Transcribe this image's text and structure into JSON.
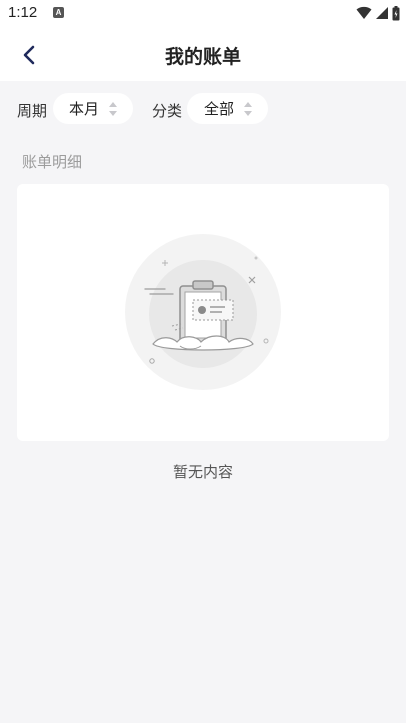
{
  "status_bar": {
    "time": "1:12",
    "app_icon_letter": "A"
  },
  "header": {
    "title": "我的账单"
  },
  "filters": {
    "period_label": "周期",
    "period_value": "本月",
    "category_label": "分类",
    "category_value": "全部"
  },
  "section": {
    "title": "账单明细"
  },
  "empty_state": {
    "text": "暂无内容"
  },
  "colors": {
    "page_background": "#f5f5f7",
    "back_icon": "#1f2a5c",
    "section_title": "#9c9c9c"
  }
}
